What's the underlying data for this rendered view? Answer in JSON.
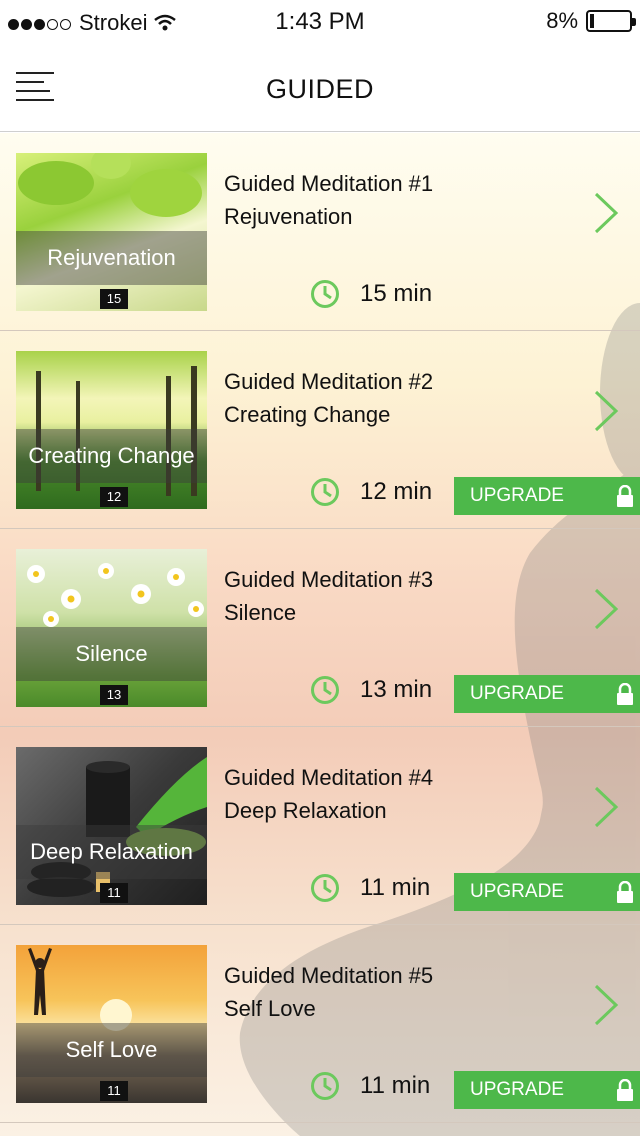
{
  "status_bar": {
    "carrier": "Strokei",
    "time": "1:43 PM",
    "battery": "8%",
    "signal_bars": 3,
    "signal_total": 5
  },
  "nav": {
    "title": "GUIDED",
    "menu_icon": "hamburger-menu-icon"
  },
  "colors": {
    "accent_green": "#4db84a",
    "clock_green": "#6cc95d"
  },
  "meditations": [
    {
      "title": "Guided Meditation #1",
      "subtitle": "Rejuvenation",
      "thumb_label": "Rejuvenation",
      "thumb_number": "15",
      "duration": "15 min",
      "locked": false
    },
    {
      "title": "Guided Meditation #2",
      "subtitle": "Creating Change",
      "thumb_label": "Creating Change",
      "thumb_number": "12",
      "duration": "12 min",
      "locked": true,
      "upgrade_label": "UPGRADE"
    },
    {
      "title": "Guided Meditation #3",
      "subtitle": "Silence",
      "thumb_label": "Silence",
      "thumb_number": "13",
      "duration": "13 min",
      "locked": true,
      "upgrade_label": "UPGRADE"
    },
    {
      "title": "Guided Meditation #4",
      "subtitle": "Deep Relaxation",
      "thumb_label": "Deep Relaxation",
      "thumb_number": "11",
      "duration": "11 min",
      "locked": true,
      "upgrade_label": "UPGRADE"
    },
    {
      "title": "Guided Meditation #5",
      "subtitle": "Self Love",
      "thumb_label": "Self Love",
      "thumb_number": "11",
      "duration": "11 min",
      "locked": true,
      "upgrade_label": "UPGRADE"
    }
  ]
}
